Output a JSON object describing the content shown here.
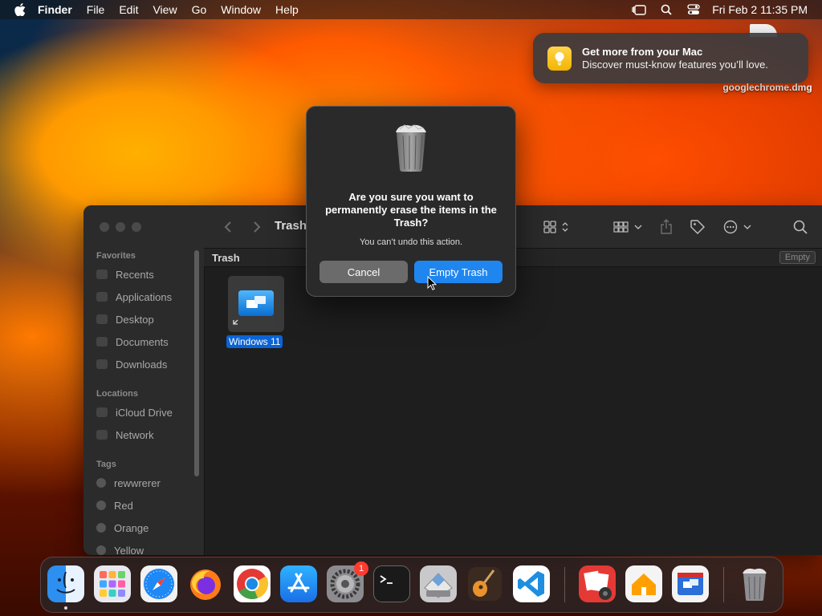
{
  "menubar": {
    "app": "Finder",
    "items": [
      "File",
      "Edit",
      "View",
      "Go",
      "Window",
      "Help"
    ],
    "status_icons": [
      "stage-manager-icon",
      "search-icon",
      "control-center-icon"
    ],
    "clock": "Fri Feb 2  11:35 PM"
  },
  "notification": {
    "icon": "lightbulb-icon",
    "title": "Get more from your Mac",
    "text": "Discover must-know features you’ll love."
  },
  "desktop": {
    "file_name": "googlechrome.dmg"
  },
  "finder": {
    "title": "Trash",
    "path_label": "Trash",
    "empty_button": "Empty",
    "sidebar": {
      "favorites_header": "Favorites",
      "favorites": [
        "Recents",
        "Applications",
        "Desktop",
        "Documents",
        "Downloads"
      ],
      "locations_header": "Locations",
      "locations": [
        "iCloud Drive",
        "Network"
      ],
      "tags_header": "Tags",
      "tags": [
        "rewwrerer",
        "Red",
        "Orange",
        "Yellow"
      ]
    },
    "items": [
      {
        "name": "Windows 11",
        "selected": true,
        "icon": "windows-app-icon"
      }
    ]
  },
  "alert": {
    "title": "Are you sure you want to permanently erase the items in the Trash?",
    "message": "You can’t undo this action.",
    "cancel_label": "Cancel",
    "confirm_label": "Empty Trash",
    "confirm_color": "#1f86f0"
  },
  "dock": {
    "apps": [
      "Finder",
      "Launchpad",
      "Safari",
      "Firefox",
      "Google Chrome",
      "App Store",
      "System Settings",
      "Terminal",
      "Boot Camp Assistant",
      "GarageBand",
      "Visual Studio Code",
      "Photo Booth",
      "Home",
      "Windows App",
      "Trash"
    ],
    "settings_badge": "1"
  },
  "colors": {
    "accent": "#1f86f0",
    "selection": "#0a64d6",
    "badge": "#ff3b30"
  }
}
